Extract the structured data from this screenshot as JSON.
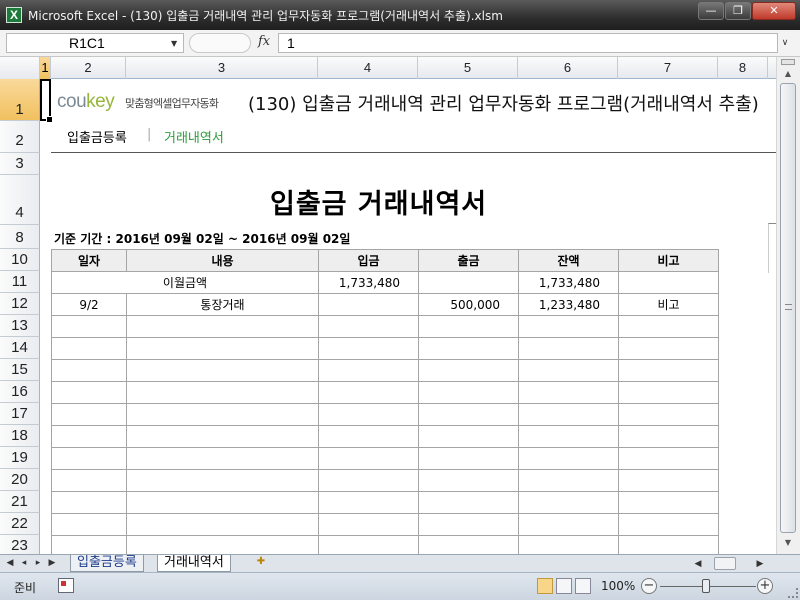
{
  "window": {
    "title": "Microsoft Excel - (130) 입출금 거래내역 관리 업무자동화 프로그램(거래내역서 추출).xlsm",
    "app_icon": "X",
    "minimize": "—",
    "restore": "❐",
    "close": "✕"
  },
  "formula_bar": {
    "name_box": "R1C1",
    "fx": "fx",
    "value": "1"
  },
  "columns": [
    "1",
    "2",
    "3",
    "4",
    "5",
    "6",
    "7",
    "8"
  ],
  "rows": [
    "1",
    "2",
    "3",
    "4",
    "8",
    "10",
    "11",
    "12",
    "13",
    "14",
    "15",
    "16",
    "17",
    "18",
    "19",
    "20",
    "21",
    "22",
    "23"
  ],
  "banner": {
    "logo_a": "cou",
    "logo_b": "key",
    "logo_tag": "맞춤형엑셀업무자동화",
    "title": "(130) 입출금 거래내역 관리 업무자동화 프로그램(거래내역서 추출)"
  },
  "nav": {
    "items": [
      "입출금등록",
      "거래내역서"
    ],
    "separator": "|"
  },
  "report": {
    "title": "입출금 거래내역서",
    "period": "기준 기간 : 2016년 09월 02일 ~ 2016년 09월 02일"
  },
  "ledger": {
    "headers": [
      "일자",
      "내용",
      "입금",
      "출금",
      "잔액",
      "비고"
    ],
    "carry_label": "이월금액",
    "carry_deposit": "1,733,480",
    "carry_balance": "1,733,480",
    "rows": [
      {
        "date": "9/2",
        "desc": "통장거래",
        "deposit": "",
        "withdraw": "500,000",
        "balance": "1,233,480",
        "note": "비고"
      }
    ]
  },
  "sheets": {
    "tabs": [
      "입출금등록",
      "거래내역서"
    ],
    "active_index": 1
  },
  "status": {
    "ready": "준비",
    "zoom": "100%"
  },
  "icons": {
    "first_sheet": "first-sheet-icon",
    "prev_sheet": "prev-sheet-icon",
    "next_sheet": "next-sheet-icon",
    "last_sheet": "last-sheet-icon",
    "new_sheet": "new-sheet-icon",
    "macro": "macro-record-icon"
  }
}
